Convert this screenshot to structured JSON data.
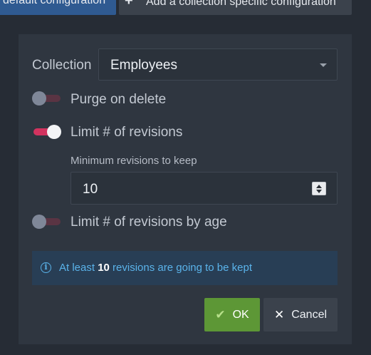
{
  "tabs": {
    "default_label": "default configuration",
    "add_plus": "+",
    "add_label": "Add a collection specific configuration"
  },
  "form": {
    "collection_label": "Collection",
    "collection_value": "Employees",
    "purge_on_delete_label": "Purge on delete",
    "purge_on_delete": false,
    "limit_revisions_label": "Limit # of revisions",
    "limit_revisions": true,
    "min_revisions_label": "Minimum revisions to keep",
    "min_revisions_value": "10",
    "limit_by_age_label": "Limit # of revisions by age",
    "limit_by_age": false
  },
  "info": {
    "icon": "info-icon",
    "prefix": "At least ",
    "count": "10",
    "suffix": " revisions are going to be kept"
  },
  "buttons": {
    "ok_label": "OK",
    "ok_icon": "check-icon",
    "cancel_label": "Cancel",
    "cancel_icon": "close-icon"
  },
  "colors": {
    "background": "#262c35",
    "panel": "#2f3640",
    "toggle_on": "#d2335f",
    "ok_button": "#5d9736",
    "info_text": "#5ab3ea",
    "tab_active": "#2f5a91"
  }
}
